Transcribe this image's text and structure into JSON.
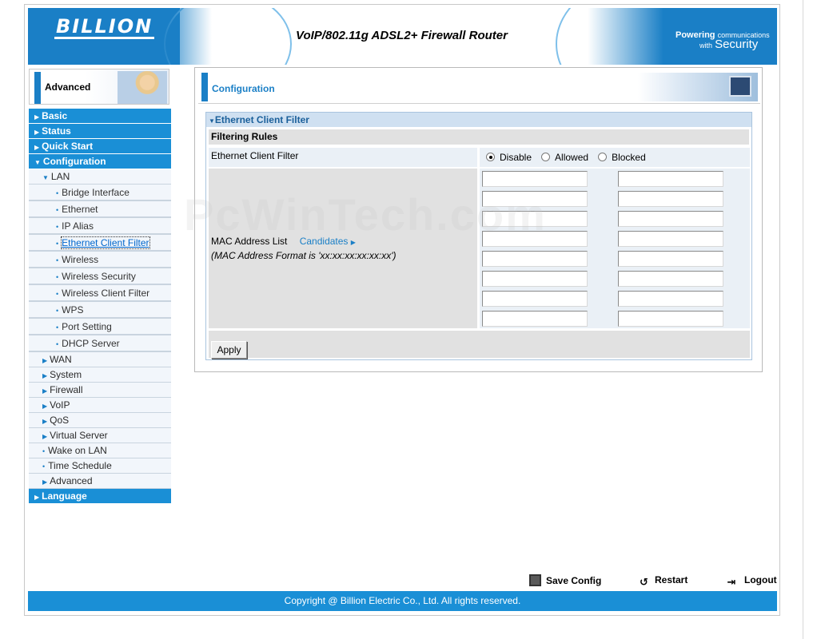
{
  "header": {
    "logo": "BILLION",
    "title": "VoIP/802.11g ADSL2+ Firewall Router",
    "tagline_powering": "Powering",
    "tagline_communications": "communications",
    "tagline_with": "with",
    "tagline_security": "Security"
  },
  "sidebar": {
    "banner_label": "Advanced",
    "items": [
      {
        "label": "Basic",
        "level": "top"
      },
      {
        "label": "Status",
        "level": "top"
      },
      {
        "label": "Quick Start",
        "level": "top"
      },
      {
        "label": "Configuration",
        "level": "top-open"
      },
      {
        "label": "LAN",
        "level": "sub-open"
      },
      {
        "label": "Bridge Interface",
        "level": "subsub"
      },
      {
        "label": "Ethernet",
        "level": "subsub"
      },
      {
        "label": "IP Alias",
        "level": "subsub"
      },
      {
        "label": "Ethernet Client Filter",
        "level": "subsub-active"
      },
      {
        "label": "Wireless",
        "level": "subsub"
      },
      {
        "label": "Wireless Security",
        "level": "subsub"
      },
      {
        "label": "Wireless Client Filter",
        "level": "subsub"
      },
      {
        "label": "WPS",
        "level": "subsub"
      },
      {
        "label": "Port Setting",
        "level": "subsub"
      },
      {
        "label": "DHCP Server",
        "level": "subsub"
      },
      {
        "label": "WAN",
        "level": "sub"
      },
      {
        "label": "System",
        "level": "sub"
      },
      {
        "label": "Firewall",
        "level": "sub"
      },
      {
        "label": "VoIP",
        "level": "sub"
      },
      {
        "label": "QoS",
        "level": "sub"
      },
      {
        "label": "Virtual Server",
        "level": "sub"
      },
      {
        "label": "Wake on LAN",
        "level": "sub-leaf"
      },
      {
        "label": "Time Schedule",
        "level": "sub-leaf"
      },
      {
        "label": "Advanced",
        "level": "sub"
      },
      {
        "label": "Language",
        "level": "top"
      }
    ]
  },
  "content": {
    "title": "Configuration",
    "section_title": "Ethernet Client Filter",
    "subsection_title": "Filtering Rules",
    "filter_label": "Ethernet Client Filter",
    "filter_options": [
      "Disable",
      "Allowed",
      "Blocked"
    ],
    "filter_selected": "Disable",
    "mac_list_label": "MAC Address List",
    "candidates_link": "Candidates",
    "mac_format_note": "(MAC Address Format is 'xx:xx:xx:xx:xx:xx')",
    "mac_entries": [
      "",
      "",
      "",
      "",
      "",
      "",
      "",
      "",
      "",
      "",
      "",
      "",
      "",
      "",
      "",
      ""
    ],
    "apply_label": "Apply"
  },
  "footer": {
    "save_config": "Save Config",
    "restart": "Restart",
    "logout": "Logout",
    "copyright": "Copyright @ Billion Electric Co., Ltd. All rights reserved."
  },
  "watermark": "PcWinTech.com",
  "colors": {
    "brand_blue": "#1a7fc6",
    "nav_blue": "#1a8fd6",
    "section_header": "#cfe0f1"
  }
}
